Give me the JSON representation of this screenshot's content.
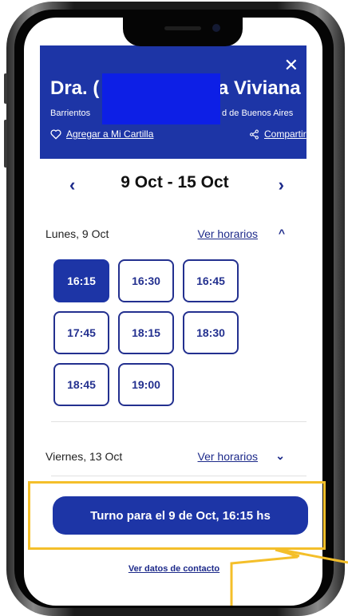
{
  "header": {
    "doctor_name_left": "Dra. (",
    "doctor_name_right": "a Viviana",
    "location_left": "Barrientos",
    "location_right": "d de Buenos Aires",
    "add_to_cartilla": "Agregar a Mi Cartilla",
    "share": "Compartir",
    "close_icon": "close-icon",
    "bg_color": "#1d35a6"
  },
  "week": {
    "prev": "‹",
    "title": "9 Oct - 15 Oct",
    "next": "›"
  },
  "days": [
    {
      "label": "Lunes, 9 Oct",
      "ver_horarios": "Ver horarios",
      "expanded": true,
      "slots": [
        "16:15",
        "16:30",
        "16:45",
        "17:45",
        "18:15",
        "18:30",
        "18:45",
        "19:00"
      ],
      "selected": "16:15"
    },
    {
      "label": "Viernes, 13 Oct",
      "ver_horarios": "Ver horarios",
      "expanded": false
    }
  ],
  "cta": {
    "label": "Turno para el 9 de Oct, 16:15 hs"
  },
  "contact": {
    "label": "Ver datos de contacto"
  },
  "colors": {
    "accent": "#1d35a6",
    "highlight": "#f4bf2a"
  }
}
